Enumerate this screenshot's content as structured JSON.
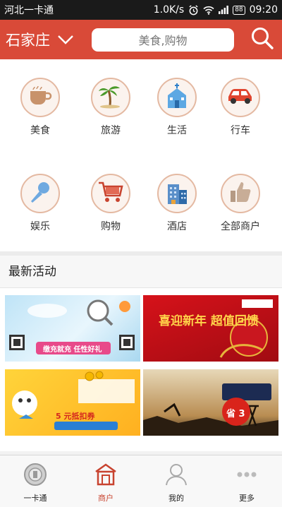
{
  "status_bar": {
    "carrier": "河北一卡通",
    "speed": "1.0K/s",
    "battery": "88",
    "time": "09:20"
  },
  "header": {
    "city": "石家庄",
    "search_placeholder": "美食,购物"
  },
  "categories": [
    {
      "label": "美食",
      "icon": "coffee-cup-icon"
    },
    {
      "label": "旅游",
      "icon": "palm-tree-icon"
    },
    {
      "label": "生活",
      "icon": "house-icon"
    },
    {
      "label": "行车",
      "icon": "car-icon"
    },
    {
      "label": "娱乐",
      "icon": "microphone-icon"
    },
    {
      "label": "购物",
      "icon": "shopping-cart-icon"
    },
    {
      "label": "酒店",
      "icon": "hotel-building-icon"
    },
    {
      "label": "全部商户",
      "icon": "thumbs-up-icon"
    }
  ],
  "activities": {
    "title": "最新活动",
    "banners": [
      {
        "caption": "缴充就充 任性好礼"
      },
      {
        "caption": "喜迎新年 超值回馈"
      },
      {
        "caption": "5 元抵扣券"
      },
      {
        "caption": "省 3"
      }
    ]
  },
  "tabbar": [
    {
      "label": "一卡通",
      "icon": "card-icon"
    },
    {
      "label": "商户",
      "icon": "shop-icon"
    },
    {
      "label": "我的",
      "icon": "person-icon"
    },
    {
      "label": "更多",
      "icon": "more-dots-icon"
    }
  ],
  "colors": {
    "brand": "#d94a38",
    "active_tab": "#c8432f"
  }
}
